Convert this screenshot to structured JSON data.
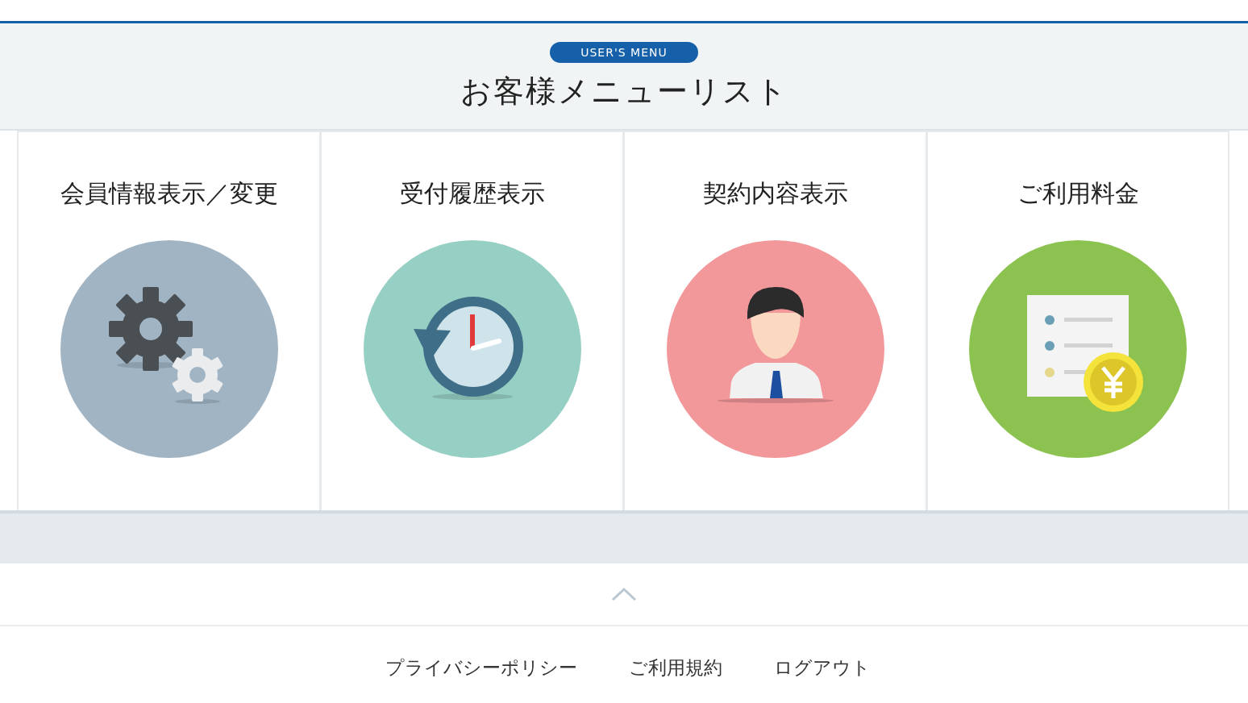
{
  "header": {
    "badge": "USER'S MENU",
    "title": "お客様メニューリスト"
  },
  "menu": [
    {
      "title": "会員情報表示／変更",
      "kind": "gears",
      "color": "#a0b4c3"
    },
    {
      "title": "受付履歴表示",
      "kind": "clock",
      "color": "#96cfc3"
    },
    {
      "title": "契約内容表示",
      "kind": "person",
      "color": "#f2979a"
    },
    {
      "title": "ご利用料金",
      "kind": "bill",
      "color": "#8cc350"
    }
  ],
  "footer": {
    "links": [
      "プライバシーポリシー",
      "ご利用規約",
      "ログアウト"
    ]
  }
}
